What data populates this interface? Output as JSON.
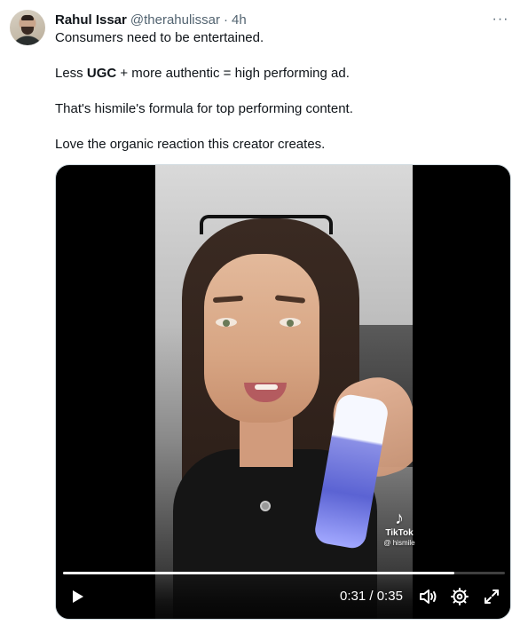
{
  "tweet": {
    "author_name": "Rahul Issar",
    "author_handle": "@therahulissar",
    "separator": "·",
    "time": "4h",
    "more_label": "···",
    "body": {
      "line1": "Consumers need to be entertained.",
      "line2_prefix": "Less ",
      "line2_bold": "UGC",
      "line2_suffix": " + more authentic = high performing ad.",
      "line3": "That's hismile's formula for top performing content.",
      "line4": "Love the organic reaction this creator creates."
    }
  },
  "video": {
    "watermark_brand": "TikTok",
    "watermark_user": "@ hismile",
    "current_time": "0:31",
    "duration": "0:35",
    "time_separator": " / ",
    "progress_fraction": 0.886,
    "icons": {
      "play": "play-icon",
      "volume": "volume-icon",
      "settings": "settings-gear-icon",
      "fullscreen": "fullscreen-icon"
    }
  }
}
